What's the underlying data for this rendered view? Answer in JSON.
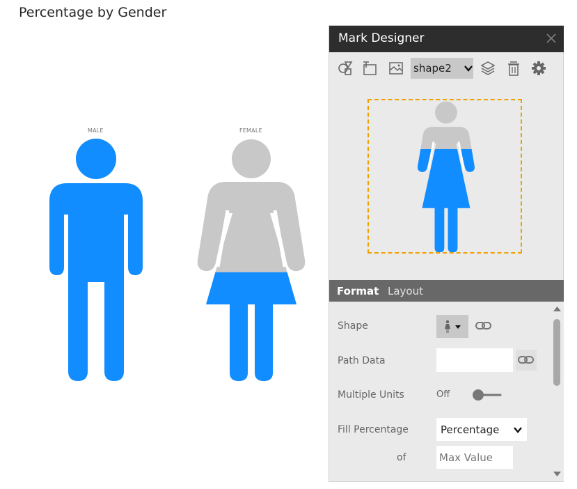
{
  "chart": {
    "title": "Percentage by Gender"
  },
  "chart_data": {
    "type": "pictogram",
    "title": "Percentage by Gender",
    "categories": [
      "MALE",
      "FEMALE"
    ],
    "fill_percentage": [
      1.0,
      0.45
    ],
    "fill_color": "#118DFF",
    "empty_color": "#C8C8C8"
  },
  "designer": {
    "title": "Mark Designer",
    "selected_shape": "shape2",
    "tabs": {
      "format": "Format",
      "layout": "Layout"
    },
    "props": {
      "shape_label": "Shape",
      "path_data_label": "Path Data",
      "path_data_value": "",
      "multiple_units_label": "Multiple Units",
      "multiple_units_value": "Off",
      "fill_percentage_label": "Fill Percentage",
      "fill_percentage_value": "Percentage",
      "of_label": "of",
      "max_value_placeholder": "Max Value"
    }
  },
  "icons": [
    "shapes-icon",
    "text-icon",
    "image-icon",
    "chevron-down-icon",
    "layers-icon",
    "trash-icon",
    "gear-icon",
    "close-icon",
    "female-shape-icon",
    "link-icon",
    "scroll-up-icon",
    "scroll-down-icon"
  ],
  "colors": {
    "accent": "#118DFF",
    "selection_border": "#F0A000"
  }
}
